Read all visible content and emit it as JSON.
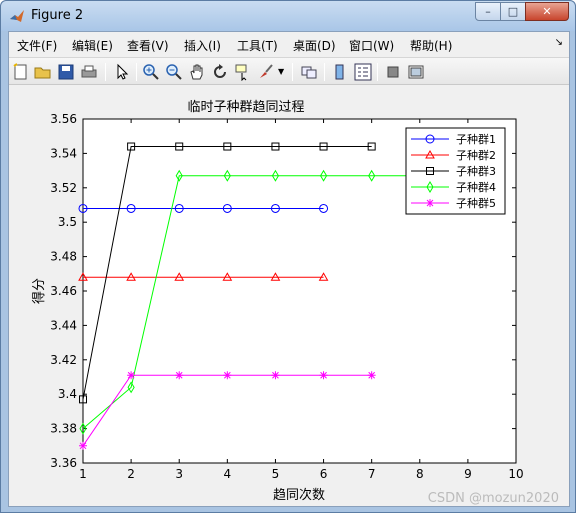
{
  "window": {
    "title": "Figure 2",
    "controls": {
      "minimize": "–",
      "maximize": "□",
      "close": "✕"
    }
  },
  "menu": {
    "items": [
      "文件(F)",
      "编辑(E)",
      "查看(V)",
      "插入(I)",
      "工具(T)",
      "桌面(D)",
      "窗口(W)",
      "帮助(H)"
    ],
    "overflow": "↘"
  },
  "toolbar": {
    "icons": [
      "new-figure-icon",
      "open-icon",
      "save-icon",
      "print-icon",
      "pointer-icon",
      "zoom-in-icon",
      "zoom-out-icon",
      "pan-hand-icon",
      "rotate-3d-icon",
      "data-cursor-icon",
      "brush-icon",
      "link-icon",
      "colorbar-icon",
      "legend-icon",
      "hide-plot-tools-icon",
      "show-plot-tools-icon"
    ]
  },
  "watermark": "CSDN @mozun2020",
  "chart_data": {
    "type": "line",
    "title": "临时子种群趋同过程",
    "xlabel": "趋同次数",
    "ylabel": "得分",
    "xlim": [
      1,
      10
    ],
    "ylim": [
      3.36,
      3.56
    ],
    "xticks": [
      1,
      2,
      3,
      4,
      5,
      6,
      7,
      8,
      9,
      10
    ],
    "yticks": [
      3.36,
      3.38,
      3.4,
      3.42,
      3.44,
      3.46,
      3.48,
      3.5,
      3.52,
      3.54,
      3.56
    ],
    "ytick_labels": [
      "3.36",
      "3.38",
      "3.4",
      "3.42",
      "3.44",
      "3.46",
      "3.48",
      "3.5",
      "3.52",
      "3.54",
      "3.56"
    ],
    "grid": false,
    "legend_position": "top-right",
    "series": [
      {
        "name": "子种群1",
        "color": "#0000ff",
        "marker": "circle",
        "x": [
          1,
          2,
          3,
          4,
          5,
          6
        ],
        "y": [
          3.508,
          3.508,
          3.508,
          3.508,
          3.508,
          3.508
        ]
      },
      {
        "name": "子种群2",
        "color": "#ff0000",
        "marker": "triangle",
        "x": [
          1,
          2,
          3,
          4,
          5,
          6
        ],
        "y": [
          3.468,
          3.468,
          3.468,
          3.468,
          3.468,
          3.468
        ]
      },
      {
        "name": "子种群3",
        "color": "#000000",
        "marker": "square",
        "x": [
          1,
          2,
          3,
          4,
          5,
          6,
          7
        ],
        "y": [
          3.397,
          3.544,
          3.544,
          3.544,
          3.544,
          3.544,
          3.544
        ]
      },
      {
        "name": "子种群4",
        "color": "#00ff00",
        "marker": "diamond",
        "x": [
          1,
          2,
          3,
          4,
          5,
          6,
          7,
          8
        ],
        "y": [
          3.38,
          3.404,
          3.527,
          3.527,
          3.527,
          3.527,
          3.527,
          3.527
        ]
      },
      {
        "name": "子种群5",
        "color": "#ff00ff",
        "marker": "asterisk",
        "x": [
          1,
          2,
          3,
          4,
          5,
          6,
          7
        ],
        "y": [
          3.37,
          3.411,
          3.411,
          3.411,
          3.411,
          3.411,
          3.411
        ]
      }
    ]
  }
}
